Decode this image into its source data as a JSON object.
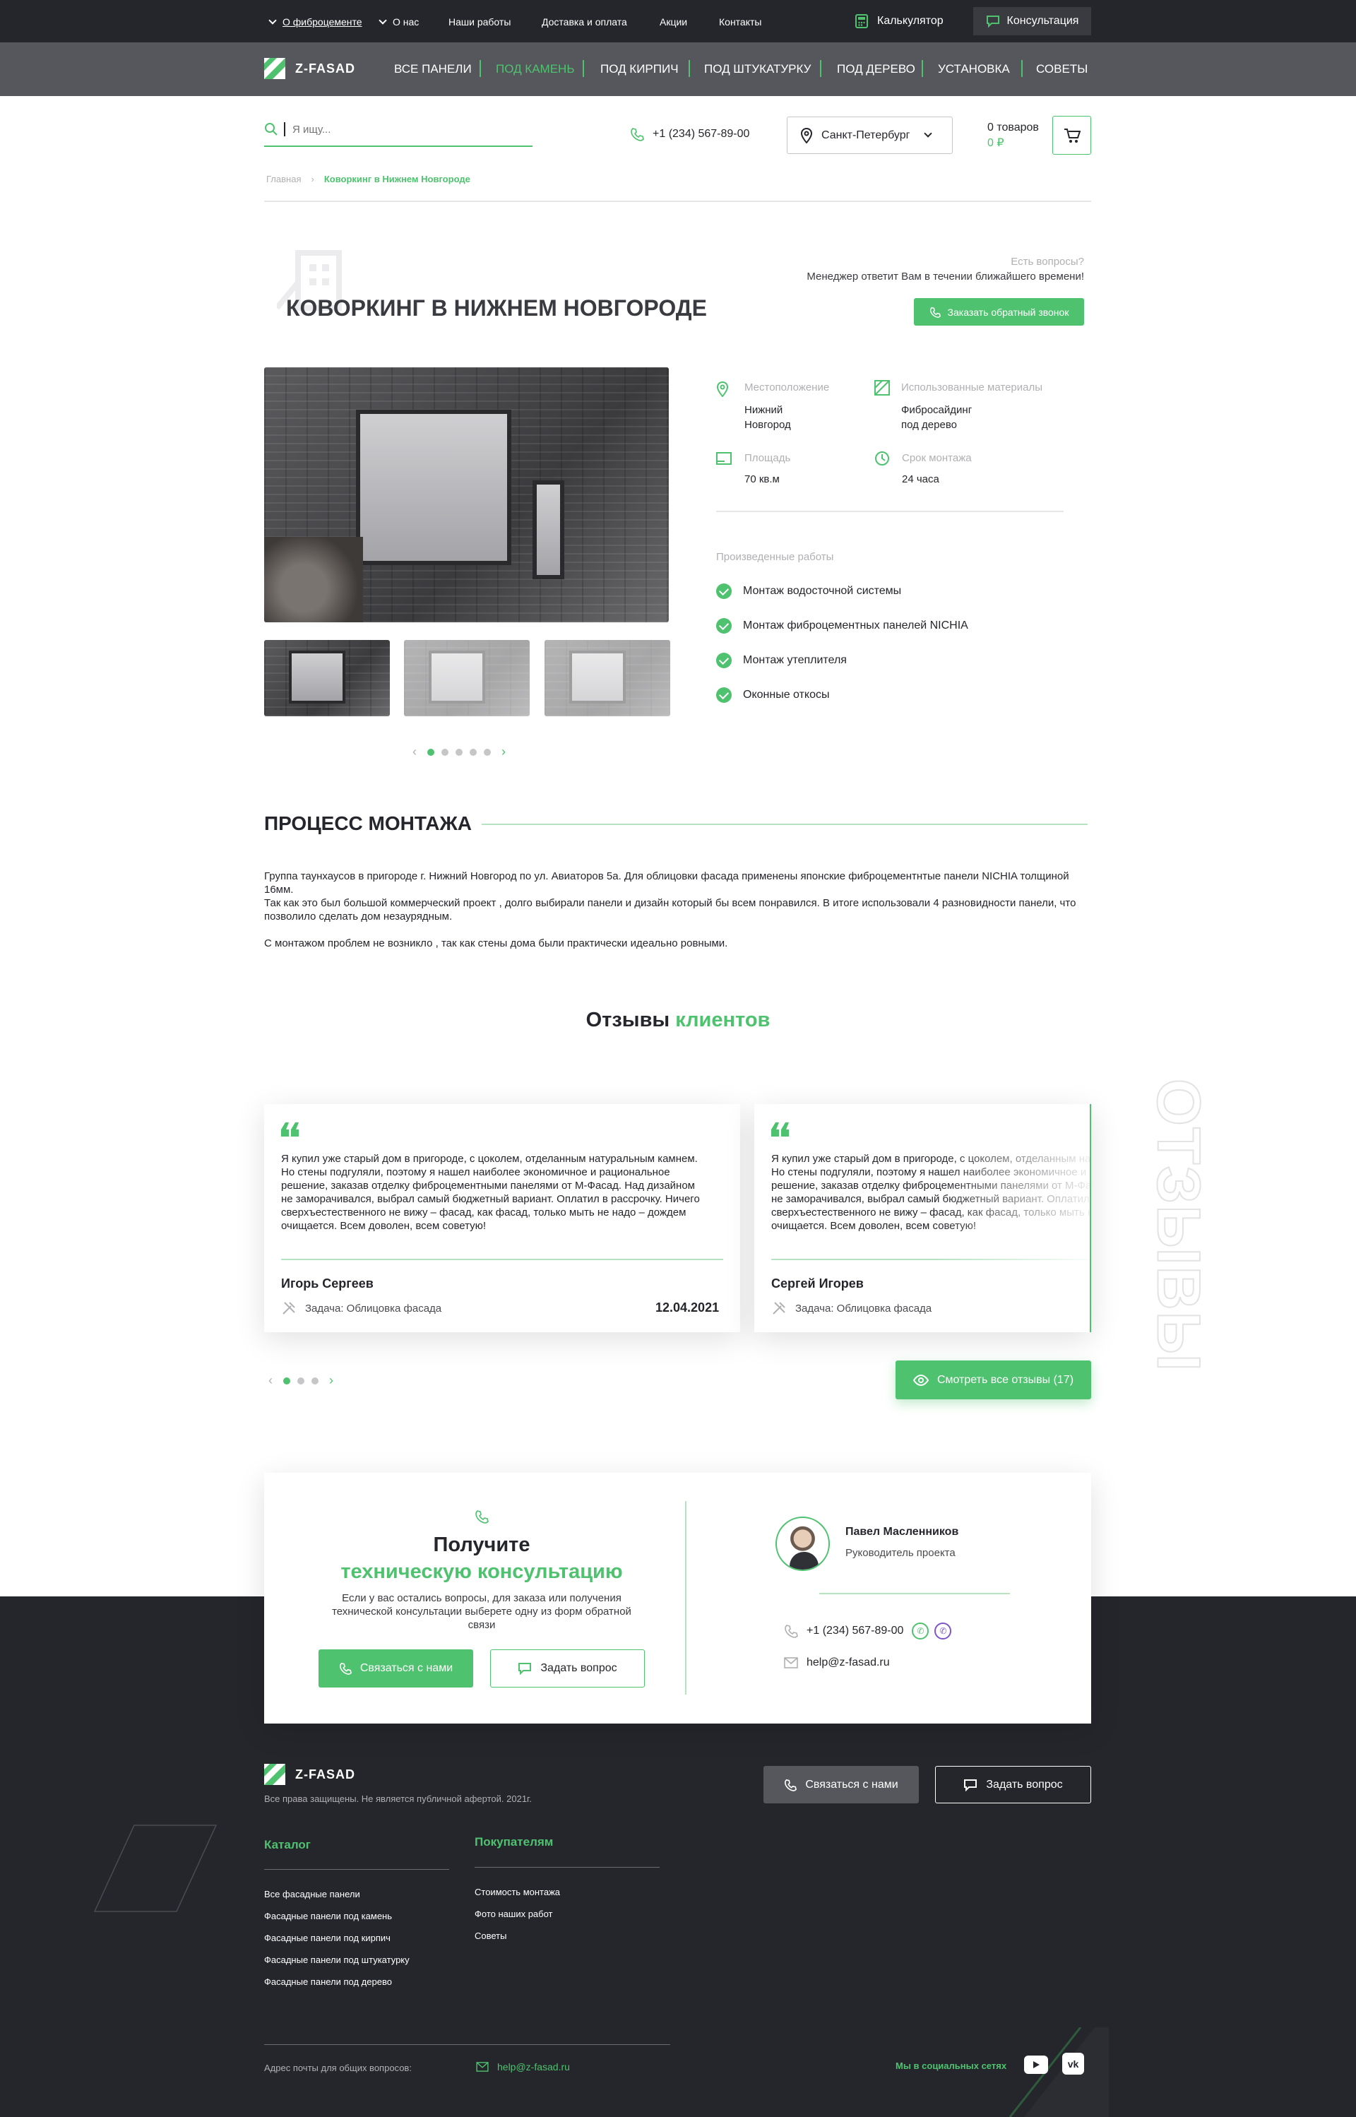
{
  "topbar": {
    "about_fiber": "О фиброцементе",
    "about": "О нас",
    "works": "Наши работы",
    "delivery": "Доставка и оплата",
    "promos": "Акции",
    "contacts": "Контакты",
    "calculator": "Калькулятор",
    "consult": "Консультация"
  },
  "brand": {
    "name": "Z-FASAD"
  },
  "nav": [
    "ВСЕ ПАНЕЛИ",
    "ПОД КАМЕНЬ",
    "ПОД КИРПИЧ",
    "ПОД ШТУКАТУРКУ",
    "ПОД ДЕРЕВО",
    "УСТАНОВКА",
    "СОВЕТЫ"
  ],
  "search": {
    "placeholder": "Я ищу..."
  },
  "header": {
    "phone": "+1 (234) 567-89-00",
    "city": "Санкт-Петербург",
    "cart_count": "0 товаров",
    "cart_sum": "0 ₽"
  },
  "breadcrumb": {
    "home": "Главная",
    "current": "Коворкинг в Нижнем Новгороде"
  },
  "hero": {
    "title": "КОВОРКИНГ В НИЖНЕМ НОВГОРОДЕ",
    "q": "Есть вопросы?",
    "manager": "Менеджер ответит Вам в течении ближайшего времени!",
    "callback": "Заказать обратный звонок"
  },
  "info": {
    "location_label": "Местоположение",
    "location_value1": "Нижний",
    "location_value2": "Новгород",
    "materials_label": "Использованные материалы",
    "materials_value1": "Фибросайдинг",
    "materials_value2": "под дерево",
    "area_label": "Площадь",
    "area_value": "70 кв.м",
    "time_label": "Срок монтажа",
    "time_value": "24 часа",
    "works_label": "Произведенные работы",
    "works": [
      "Монтаж водосточной системы",
      "Монтаж фиброцементных панелей NICHIA",
      "Монтаж утеплителя",
      "Оконные откосы"
    ]
  },
  "process": {
    "title": "ПРОЦЕСС МОНТАЖА",
    "p1": "Группа таунхаусов в пригороде г. Нижний Новгород по ул. Авиаторов 5а. Для облицовки фасада применены японские фиброцементнтые панели NICHIA толщиной 16мм.",
    "p2": "Так как это был большой коммерческий проект , долго выбирали панели и дизайн который бы всем понравился. В итоге использовали 4 разновидности панели, что позволило сделать дом незаурядным.",
    "p3": "С монтажом проблем не возникло , так как стены дома были практически идеально ровными."
  },
  "reviews": {
    "title_a": "Отзывы",
    "title_b": "клиентов",
    "watermark": "ОТЗЫВЫ",
    "text": "Я купил уже старый дом в пригороде, с цоколем, отделанным натуральным камнем. Но стены подгуляли, поэтому я нашел наиболее экономичное и рациональное решение, заказав отделку фиброцементными панелями от М-Фасад. Над дизайном не заморачивался, выбрал самый бюджетный вариант. Оплатил в рассрочку. Ничего сверхъестественного не вижу – фасад, как фасад, только мыть не надо – дождем очищается. Всем доволен, всем советую!",
    "name1": "Игорь Сергеев",
    "name2": "Сергей Игорев",
    "task": "Задача: Облицовка фасада",
    "date1": "12.04.2021",
    "see_all": "Смотреть все отзывы (17)"
  },
  "consult": {
    "title1": "Получите",
    "title2": "техническую консультацию",
    "desc": "Если у вас остались вопросы, для заказа или получения технической консультации выберете одну из форм обратной связи",
    "contact_btn": "Связаться с нами",
    "ask_btn": "Задать вопрос",
    "manager_name": "Павел Масленников",
    "manager_role": "Руководитель проекта",
    "phone": "+1 (234) 567-89-00",
    "email": "help@z-fasad.ru"
  },
  "footer": {
    "rights": "Все права защищены. Не является публичной афертой. 2021г.",
    "contact_btn": "Связаться с нами",
    "ask_btn": "Задать вопрос",
    "catalog_title": "Каталог",
    "catalog": [
      "Все фасадные панели",
      "Фасадные панели под камень",
      "Фасадные панели под кирпич",
      "Фасадные панели под штукатурку",
      "Фасадные панели под дерево"
    ],
    "buyers_title": "Покупателям",
    "buyers": [
      "Стоимость монтажа",
      "Фото наших работ",
      "Советы"
    ],
    "email_label": "Адрес почты для общих вопросов:",
    "email": "help@z-fasad.ru",
    "social_label": "Мы в социальных сетях"
  },
  "colors": {
    "accent": "#4ec26e",
    "dark": "#25262c",
    "nav": "#56575c"
  }
}
